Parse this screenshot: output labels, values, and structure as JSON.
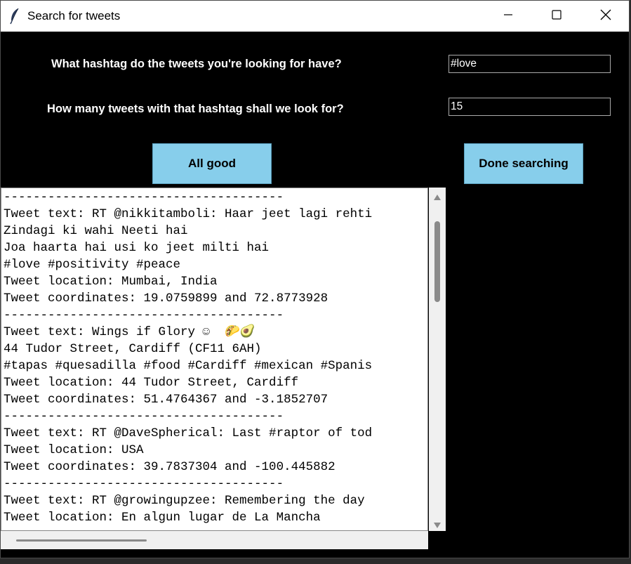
{
  "window": {
    "title": "Search for tweets"
  },
  "form": {
    "hashtag_label": "What hashtag do the tweets you're looking for have?",
    "hashtag_value": "#love",
    "count_label": "How many tweets with that hashtag shall we look for?",
    "count_value": "15"
  },
  "buttons": {
    "all_good": "All good",
    "done_searching": "Done searching"
  },
  "output": {
    "lines": [
      "--------------------------------------",
      "Tweet text: RT @nikkitamboli: Haar jeet lagi rehti",
      "Zindagi ki wahi Neeti hai",
      "Joa haarta hai usi ko jeet milti hai",
      "#love #positivity #peace",
      "Tweet location: Mumbai, India",
      "Tweet coordinates: 19.0759899 and 72.8773928",
      "--------------------------------------",
      "Tweet text: Wings if Glory ☺  🌮🥑",
      "44 Tudor Street, Cardiff (CF11 6AH)",
      "#tapas #quesadilla #food #Cardiff #mexican #Spanis",
      "Tweet location: 44 Tudor Street, Cardiff",
      "Tweet coordinates: 51.4764367 and -3.1852707",
      "--------------------------------------",
      "Tweet text: RT @DaveSpherical: Last #raptor of tod",
      "Tweet location: USA",
      "Tweet coordinates: 39.7837304 and -100.445882",
      "--------------------------------------",
      "Tweet text: RT @growingupzee: Remembering the day",
      "Tweet location: En algun lugar de La Mancha"
    ]
  },
  "icons": {
    "app": "feather-icon",
    "minimize": "minimize-icon",
    "maximize": "maximize-icon",
    "close": "close-icon"
  },
  "colors": {
    "background": "#000000",
    "button": "#87ceeb",
    "text": "#ffffff"
  }
}
